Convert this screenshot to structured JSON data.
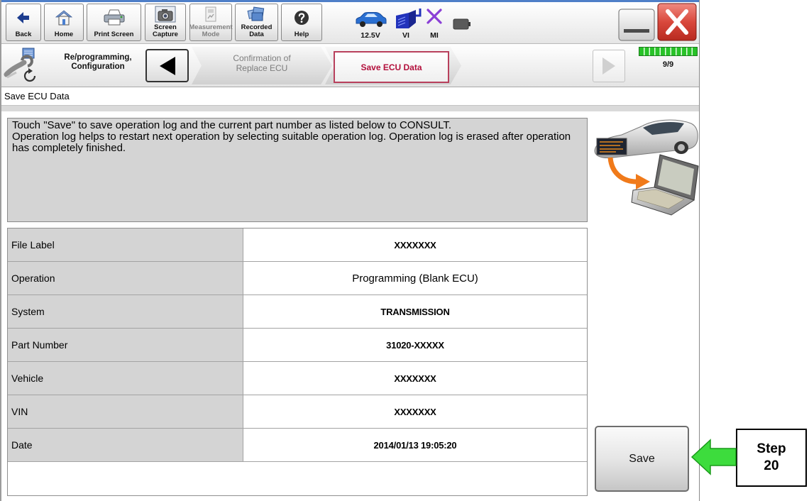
{
  "window": {
    "minimize_icon": "minimize-icon",
    "close_icon": "close-icon"
  },
  "toolbar": {
    "buttons": [
      {
        "label": "Back",
        "icon": "back-arrow-icon"
      },
      {
        "label": "Home",
        "icon": "home-icon"
      },
      {
        "label": "Print Screen",
        "icon": "printer-icon"
      },
      {
        "label": "Screen\nCapture",
        "icon": "camera-icon"
      },
      {
        "label": "Measurement\nMode",
        "icon": "measurement-icon",
        "enabled": false
      },
      {
        "label": "Recorded\nData",
        "icon": "recorded-data-icon"
      },
      {
        "label": "Help",
        "icon": "help-icon"
      }
    ],
    "status": {
      "battery_voltage": "12.5V",
      "vi_label": "VI",
      "mi_label": "MI",
      "icons": [
        "vehicle-icon",
        "vi-icon",
        "mi-icon",
        "battery-icon"
      ]
    }
  },
  "nav": {
    "mode_label": "Re/programming,\nConfiguration",
    "mode_icon": "reprogramming-icon",
    "steps": [
      {
        "label": "Confirmation of\nReplace ECU"
      },
      {
        "label": "Save ECU Data"
      }
    ],
    "progress": {
      "label": "9/9",
      "fraction": 1.0
    }
  },
  "page": {
    "title": "Save ECU Data",
    "instructions": "Touch \"Save\" to save operation log and the current part number as listed below to CONSULT.\nOperation log helps to restart next operation by selecting suitable operation log. Operation log is erased after operation has completely finished.",
    "illustration_icon": "car-to-laptop-icon"
  },
  "table": {
    "rows": [
      {
        "label": "File Label",
        "value": "XXXXXXX"
      },
      {
        "label": "Operation",
        "value": "Programming (Blank ECU)"
      },
      {
        "label": "System",
        "value": "TRANSMISSION"
      },
      {
        "label": "Part Number",
        "value": "31020-XXXXX"
      },
      {
        "label": "Vehicle",
        "value": "XXXXXXX"
      },
      {
        "label": "VIN",
        "value": "XXXXXXX"
      },
      {
        "label": "Date",
        "value": "2014/01/13 19:05:20"
      }
    ]
  },
  "save_button": {
    "label": "Save"
  },
  "callout": {
    "label": "Step",
    "number": "20",
    "arrow_icon": "green-arrow-left-icon"
  },
  "colors": {
    "active_step": "#b3103c",
    "progress_fill": "#28c228",
    "callout_arrow": "#3ddc3d"
  }
}
